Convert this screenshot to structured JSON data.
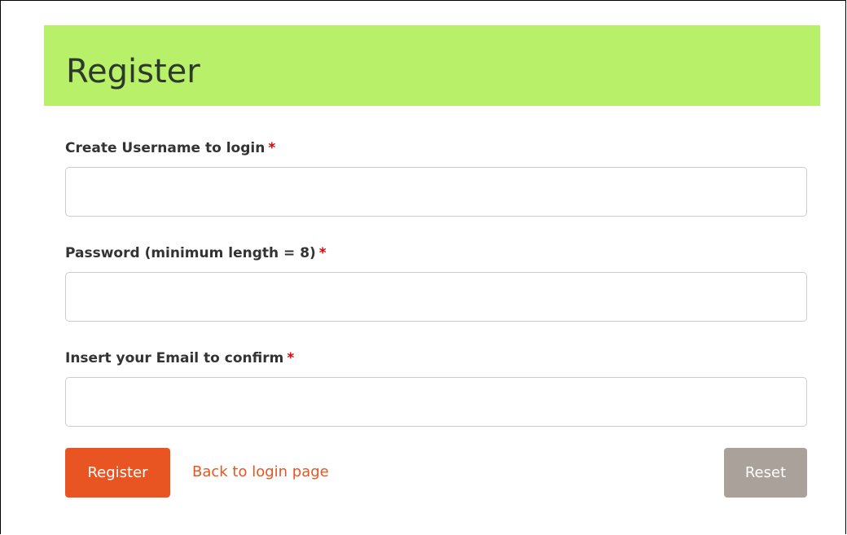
{
  "header": {
    "title": "Register",
    "background_color": "#b9f069"
  },
  "form": {
    "fields": [
      {
        "label": "Create Username to login",
        "required_marker": "*",
        "value": "",
        "placeholder": ""
      },
      {
        "label": "Password (minimum length = 8)",
        "required_marker": "*",
        "value": "",
        "placeholder": ""
      },
      {
        "label": "Insert your Email to confirm",
        "required_marker": "*",
        "value": "",
        "placeholder": ""
      }
    ],
    "actions": {
      "register_label": "Register",
      "back_link_label": "Back to login page",
      "reset_label": "Reset"
    }
  },
  "colors": {
    "accent": "#e85522",
    "required": "#e20000",
    "reset_button": "#aaa29a"
  }
}
